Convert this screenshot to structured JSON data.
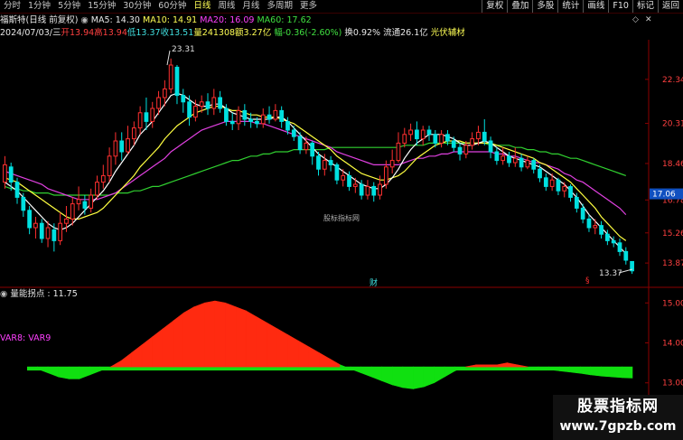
{
  "toolbar": {
    "periods": [
      "分时",
      "1分钟",
      "5分钟",
      "15分钟",
      "30分钟",
      "60分钟",
      "日线",
      "周线",
      "月线",
      "多周期",
      "更多"
    ],
    "active_period": "日线",
    "tools": [
      "复权",
      "叠加",
      "多股",
      "统计",
      "画线",
      "F10",
      "标记",
      "返回"
    ]
  },
  "info1": {
    "name": "福斯特(日线 前复权)",
    "ma5": "MA5: 14.30",
    "ma10": "MA10: 14.91",
    "ma20": "MA20: 16.09",
    "ma60": "MA60: 17.62"
  },
  "info2": {
    "date": "2024/07/03/三",
    "open": "开13.94",
    "high": "高13.94",
    "low": "低13.37",
    "close": "收13.51",
    "volume": "量241308",
    "amount": "额3.27亿",
    "change": "幅-0.36(-2.60%)",
    "turnover": "换0.92%",
    "float_cap": "流通26.1亿",
    "sector": "光伏辅材"
  },
  "main_axis": {
    "ticks": [
      "22.34",
      "20.31",
      "18.46",
      "16.78",
      "15.26",
      "13.87"
    ],
    "current_price": "17.06"
  },
  "annotations": {
    "high_mark": "23.31",
    "low_mark": "13.37",
    "cai": "财",
    "s_mark": "§",
    "center": "股标指标网"
  },
  "sub_panel": {
    "title": "量能拐点 : 11.75",
    "var_label": "VAR8: VAR9",
    "ticks": [
      "15.00",
      "14.00",
      "13.00"
    ]
  },
  "watermark": {
    "line1": "股票指标网",
    "line2": "www.7gpzb.com"
  },
  "colors": {
    "up": "#ff3030",
    "down": "#00e0e0",
    "ma5": "#ffffff",
    "ma10": "#ffff40",
    "ma20": "#e040e0",
    "ma60": "#30d030",
    "fill_pos": "#ff2a10",
    "fill_neg": "#10e010"
  },
  "chart_data": {
    "type": "candlestick",
    "y_range": [
      13.0,
      24.0
    ],
    "candles": [
      [
        17.6,
        18.4,
        18.8,
        17.3
      ],
      [
        18.3,
        17.6,
        18.5,
        17.2
      ],
      [
        17.6,
        16.9,
        17.8,
        16.6
      ],
      [
        16.9,
        16.3,
        17.1,
        16.0
      ],
      [
        16.3,
        15.5,
        16.5,
        15.2
      ],
      [
        15.5,
        15.7,
        16.0,
        15.0
      ],
      [
        15.7,
        15.0,
        15.9,
        14.8
      ],
      [
        15.0,
        15.5,
        15.8,
        14.6
      ],
      [
        15.4,
        14.9,
        15.7,
        14.4
      ],
      [
        14.9,
        15.7,
        16.2,
        14.7
      ],
      [
        15.7,
        15.9,
        16.5,
        15.3
      ],
      [
        15.9,
        16.6,
        16.9,
        15.6
      ],
      [
        16.6,
        16.8,
        17.4,
        16.3
      ],
      [
        16.7,
        16.4,
        17.0,
        16.1
      ],
      [
        16.4,
        17.0,
        17.3,
        16.2
      ],
      [
        17.0,
        17.6,
        17.9,
        16.8
      ],
      [
        17.6,
        17.9,
        18.4,
        17.3
      ],
      [
        17.9,
        18.8,
        19.2,
        17.6
      ],
      [
        18.8,
        19.5,
        19.9,
        18.4
      ],
      [
        19.5,
        19.0,
        19.9,
        18.6
      ],
      [
        19.0,
        19.6,
        20.2,
        18.9
      ],
      [
        19.6,
        20.1,
        20.4,
        19.3
      ],
      [
        20.1,
        20.8,
        21.1,
        19.8
      ],
      [
        20.8,
        20.4,
        21.5,
        20.0
      ],
      [
        20.4,
        21.0,
        21.3,
        20.1
      ],
      [
        21.0,
        21.5,
        21.8,
        20.7
      ],
      [
        21.5,
        21.9,
        22.3,
        21.1
      ],
      [
        21.9,
        23.0,
        23.3,
        21.7
      ],
      [
        22.9,
        21.6,
        23.0,
        21.2
      ],
      [
        21.6,
        21.3,
        21.9,
        20.8
      ],
      [
        21.3,
        20.6,
        21.6,
        20.2
      ],
      [
        20.6,
        21.1,
        21.4,
        20.4
      ],
      [
        21.1,
        21.3,
        21.6,
        20.8
      ],
      [
        21.3,
        21.0,
        21.7,
        20.7
      ],
      [
        21.0,
        21.5,
        21.9,
        20.7
      ],
      [
        21.5,
        21.0,
        21.8,
        20.8
      ],
      [
        21.0,
        20.4,
        21.2,
        20.2
      ],
      [
        20.4,
        20.3,
        20.8,
        20.0
      ],
      [
        20.3,
        20.9,
        21.1,
        20.0
      ],
      [
        20.9,
        20.5,
        21.2,
        20.2
      ],
      [
        20.5,
        20.4,
        20.8,
        20.1
      ],
      [
        20.4,
        20.3,
        20.6,
        20.1
      ],
      [
        20.3,
        20.7,
        21.0,
        20.1
      ],
      [
        20.7,
        20.5,
        21.1,
        20.3
      ],
      [
        20.5,
        20.9,
        21.2,
        20.4
      ],
      [
        20.9,
        20.4,
        21.1,
        20.1
      ],
      [
        20.4,
        20.0,
        20.6,
        19.8
      ],
      [
        20.0,
        19.7,
        20.2,
        19.5
      ],
      [
        19.7,
        19.1,
        19.9,
        18.9
      ],
      [
        19.1,
        19.4,
        19.7,
        18.9
      ],
      [
        19.4,
        18.8,
        19.5,
        18.4
      ],
      [
        18.8,
        18.2,
        19.0,
        17.9
      ],
      [
        18.2,
        18.6,
        18.9,
        17.9
      ],
      [
        18.6,
        18.4,
        18.8,
        18.1
      ],
      [
        18.4,
        17.7,
        18.5,
        17.5
      ],
      [
        17.7,
        17.9,
        18.2,
        17.4
      ],
      [
        17.9,
        17.4,
        18.1,
        17.2
      ],
      [
        17.4,
        17.5,
        17.8,
        17.1
      ],
      [
        17.5,
        17.0,
        17.7,
        16.8
      ],
      [
        17.0,
        17.4,
        17.7,
        16.8
      ],
      [
        17.4,
        17.0,
        17.6,
        16.7
      ],
      [
        17.0,
        17.5,
        17.9,
        16.8
      ],
      [
        17.5,
        18.3,
        18.6,
        17.3
      ],
      [
        18.3,
        18.6,
        19.1,
        18.0
      ],
      [
        18.6,
        19.4,
        19.9,
        18.5
      ],
      [
        19.4,
        19.8,
        20.1,
        19.2
      ],
      [
        19.8,
        20.0,
        20.3,
        19.5
      ],
      [
        20.0,
        19.6,
        20.4,
        19.3
      ],
      [
        19.6,
        20.0,
        20.2,
        19.3
      ],
      [
        20.0,
        19.8,
        20.2,
        19.5
      ],
      [
        19.8,
        19.4,
        20.0,
        19.2
      ],
      [
        19.4,
        19.8,
        20.0,
        19.2
      ],
      [
        19.8,
        19.5,
        20.0,
        19.3
      ],
      [
        19.5,
        19.2,
        19.7,
        19.0
      ],
      [
        19.2,
        18.9,
        19.4,
        18.6
      ],
      [
        18.9,
        19.3,
        19.5,
        18.7
      ],
      [
        19.3,
        19.6,
        19.9,
        19.1
      ],
      [
        19.6,
        19.9,
        20.2,
        19.3
      ],
      [
        19.9,
        19.5,
        20.5,
        19.3
      ],
      [
        19.5,
        19.0,
        19.7,
        18.7
      ],
      [
        19.0,
        18.6,
        19.2,
        18.4
      ],
      [
        18.6,
        18.8,
        19.2,
        18.4
      ],
      [
        18.8,
        18.5,
        19.0,
        18.3
      ],
      [
        18.5,
        18.7,
        19.2,
        18.3
      ],
      [
        18.7,
        18.3,
        18.9,
        18.1
      ],
      [
        18.3,
        18.6,
        18.8,
        18.2
      ],
      [
        18.6,
        18.2,
        18.7,
        18.0
      ],
      [
        18.2,
        17.8,
        18.4,
        17.6
      ],
      [
        17.8,
        17.4,
        18.0,
        17.2
      ],
      [
        17.4,
        17.7,
        18.0,
        17.2
      ],
      [
        17.7,
        17.2,
        17.8,
        17.0
      ],
      [
        17.2,
        17.4,
        17.6,
        16.9
      ],
      [
        17.4,
        16.9,
        17.5,
        16.7
      ],
      [
        16.9,
        16.4,
        17.1,
        16.2
      ],
      [
        16.4,
        15.9,
        16.6,
        15.7
      ],
      [
        15.9,
        15.5,
        16.1,
        15.3
      ],
      [
        15.5,
        15.6,
        15.9,
        15.2
      ],
      [
        15.6,
        15.2,
        15.8,
        15.0
      ],
      [
        15.2,
        14.9,
        15.4,
        14.7
      ],
      [
        14.9,
        14.8,
        15.1,
        14.6
      ],
      [
        14.8,
        14.4,
        15.0,
        14.2
      ],
      [
        14.4,
        14.0,
        14.6,
        13.8
      ],
      [
        13.94,
        13.51,
        13.94,
        13.37
      ]
    ],
    "ma5": [
      17.6,
      17.4,
      17.2,
      16.9,
      16.6,
      16.3,
      16.0,
      15.7,
      15.5,
      15.4,
      15.5,
      15.7,
      16.0,
      16.3,
      16.6,
      16.9,
      17.2,
      17.6,
      18.1,
      18.5,
      18.9,
      19.3,
      19.8,
      20.1,
      20.4,
      20.8,
      21.2,
      21.6,
      21.7,
      21.6,
      21.4,
      21.2,
      21.1,
      21.1,
      21.2,
      21.2,
      21.0,
      20.8,
      20.7,
      20.6,
      20.5,
      20.5,
      20.5,
      20.5,
      20.6,
      20.6,
      20.4,
      20.1,
      19.8,
      19.5,
      19.2,
      18.9,
      18.7,
      18.5,
      18.3,
      18.1,
      17.9,
      17.7,
      17.5,
      17.4,
      17.3,
      17.3,
      17.5,
      17.8,
      18.2,
      18.7,
      19.1,
      19.4,
      19.6,
      19.8,
      19.8,
      19.8,
      19.7,
      19.6,
      19.4,
      19.3,
      19.3,
      19.4,
      19.5,
      19.4,
      19.2,
      19.0,
      18.8,
      18.7,
      18.6,
      18.5,
      18.4,
      18.3,
      18.1,
      17.9,
      17.7,
      17.5,
      17.2,
      16.9,
      16.5,
      16.1,
      15.8,
      15.5,
      15.2,
      14.9,
      14.6,
      14.3
    ],
    "ma10": [
      17.8,
      17.7,
      17.6,
      17.4,
      17.2,
      17.0,
      16.8,
      16.6,
      16.4,
      16.2,
      16.0,
      15.9,
      15.9,
      16.0,
      16.1,
      16.2,
      16.4,
      16.7,
      17.0,
      17.3,
      17.6,
      17.9,
      18.3,
      18.6,
      18.9,
      19.2,
      19.6,
      19.9,
      20.2,
      20.4,
      20.6,
      20.8,
      20.9,
      21.0,
      21.1,
      21.1,
      21.0,
      20.9,
      20.9,
      20.8,
      20.7,
      20.7,
      20.6,
      20.6,
      20.6,
      20.5,
      20.4,
      20.3,
      20.1,
      19.9,
      19.7,
      19.5,
      19.3,
      19.1,
      18.8,
      18.6,
      18.4,
      18.2,
      18.0,
      17.9,
      17.8,
      17.7,
      17.7,
      17.8,
      17.9,
      18.1,
      18.4,
      18.7,
      18.9,
      19.1,
      19.3,
      19.4,
      19.5,
      19.5,
      19.5,
      19.4,
      19.4,
      19.4,
      19.4,
      19.4,
      19.3,
      19.2,
      19.1,
      19.0,
      18.9,
      18.8,
      18.7,
      18.5,
      18.4,
      18.2,
      18.0,
      17.8,
      17.6,
      17.3,
      17.0,
      16.7,
      16.4,
      16.0,
      15.7,
      15.4,
      15.1,
      14.9
    ],
    "ma20": [
      18.1,
      18.0,
      17.9,
      17.8,
      17.7,
      17.6,
      17.5,
      17.3,
      17.2,
      17.1,
      17.0,
      16.9,
      16.8,
      16.8,
      16.8,
      16.8,
      16.9,
      17.0,
      17.1,
      17.3,
      17.5,
      17.7,
      17.9,
      18.1,
      18.3,
      18.5,
      18.7,
      19.0,
      19.2,
      19.4,
      19.6,
      19.8,
      20.0,
      20.1,
      20.2,
      20.3,
      20.4,
      20.4,
      20.4,
      20.4,
      20.4,
      20.3,
      20.3,
      20.2,
      20.1,
      20.0,
      19.9,
      19.8,
      19.7,
      19.6,
      19.5,
      19.4,
      19.3,
      19.2,
      19.0,
      18.9,
      18.8,
      18.7,
      18.6,
      18.5,
      18.4,
      18.4,
      18.4,
      18.4,
      18.4,
      18.5,
      18.6,
      18.7,
      18.7,
      18.8,
      18.8,
      18.9,
      18.9,
      19.0,
      19.0,
      19.0,
      19.0,
      19.0,
      19.0,
      19.0,
      18.9,
      18.9,
      18.8,
      18.8,
      18.7,
      18.6,
      18.5,
      18.5,
      18.4,
      18.3,
      18.2,
      18.0,
      17.9,
      17.7,
      17.6,
      17.4,
      17.2,
      17.0,
      16.8,
      16.6,
      16.4,
      16.1
    ],
    "ma60": [
      17.4,
      17.3,
      17.3,
      17.2,
      17.2,
      17.1,
      17.1,
      17.1,
      17.0,
      17.0,
      17.0,
      17.0,
      17.0,
      17.0,
      17.0,
      17.0,
      17.0,
      17.0,
      17.1,
      17.1,
      17.1,
      17.2,
      17.2,
      17.3,
      17.4,
      17.4,
      17.5,
      17.6,
      17.7,
      17.8,
      17.9,
      18.0,
      18.1,
      18.2,
      18.3,
      18.4,
      18.5,
      18.6,
      18.6,
      18.7,
      18.8,
      18.8,
      18.9,
      18.9,
      19.0,
      19.0,
      19.0,
      19.1,
      19.1,
      19.1,
      19.1,
      19.1,
      19.1,
      19.2,
      19.2,
      19.2,
      19.2,
      19.2,
      19.2,
      19.2,
      19.2,
      19.2,
      19.2,
      19.2,
      19.2,
      19.3,
      19.3,
      19.3,
      19.3,
      19.4,
      19.4,
      19.4,
      19.4,
      19.4,
      19.4,
      19.4,
      19.4,
      19.4,
      19.4,
      19.3,
      19.3,
      19.3,
      19.3,
      19.2,
      19.2,
      19.1,
      19.1,
      19.0,
      19.0,
      18.9,
      18.9,
      18.8,
      18.7,
      18.7,
      18.6,
      18.5,
      18.4,
      18.3,
      18.2,
      18.1,
      18.0,
      17.9
    ],
    "sub_y_range": [
      12.7,
      15.3
    ],
    "sub_baseline": 13.4,
    "sub_series": [
      13.4,
      13.35,
      13.25,
      13.15,
      13.1,
      13.1,
      13.2,
      13.3,
      13.4,
      13.55,
      13.75,
      13.95,
      14.15,
      14.35,
      14.55,
      14.75,
      14.9,
      15.0,
      15.05,
      15.0,
      14.9,
      14.8,
      14.65,
      14.5,
      14.35,
      14.2,
      14.05,
      13.9,
      13.75,
      13.6,
      13.45,
      13.35,
      13.25,
      13.15,
      13.05,
      12.95,
      12.88,
      12.85,
      12.9,
      13.0,
      13.15,
      13.3,
      13.4,
      13.45,
      13.45,
      13.45,
      13.5,
      13.45,
      13.4,
      13.35,
      13.33,
      13.3,
      13.27,
      13.24,
      13.2,
      13.17,
      13.15,
      13.13,
      13.12
    ]
  }
}
